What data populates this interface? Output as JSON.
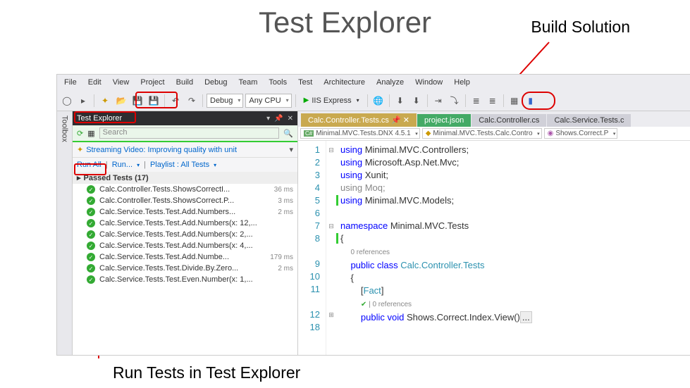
{
  "title": "Test Explorer",
  "annotations": {
    "build": "Build Solution",
    "run": "Run Tests in Test Explorer"
  },
  "menu": [
    "File",
    "Edit",
    "View",
    "Project",
    "Build",
    "Debug",
    "Team",
    "Tools",
    "Test",
    "Architecture",
    "Analyze",
    "Window",
    "Help"
  ],
  "toolbar": {
    "config": "Debug",
    "platform": "Any CPU",
    "start": "IIS Express"
  },
  "testExplorer": {
    "title": "Test Explorer",
    "searchPlaceholder": "Search",
    "streamingLink": "Streaming Video: Improving quality with unit",
    "actions": {
      "runAll": "Run All",
      "run": "Run...",
      "playlist": "Playlist : All Tests"
    },
    "groupLabel": "Passed Tests (17)",
    "tests": [
      {
        "name": "Calc.Controller.Tests.ShowsCorrectI...",
        "time": "36 ms"
      },
      {
        "name": "Calc.Controller.Tests.ShowsCorrect.P...",
        "time": "3 ms"
      },
      {
        "name": "Calc.Service.Tests.Test.Add.Numbers...",
        "time": "2 ms"
      },
      {
        "name": "Calc.Service.Tests.Test.Add.Numbers(x: 12,...",
        "time": ""
      },
      {
        "name": "Calc.Service.Tests.Test.Add.Numbers(x: 2,...",
        "time": ""
      },
      {
        "name": "Calc.Service.Tests.Test.Add.Numbers(x: 4,...",
        "time": ""
      },
      {
        "name": "Calc.Service.Tests.Test.Add.Numbe...",
        "time": "179 ms"
      },
      {
        "name": "Calc.Service.Tests.Test.Divide.By.Zero...",
        "time": "2 ms"
      },
      {
        "name": "Calc.Service.Tests.Test.Even.Number(x: 1,...",
        "time": ""
      }
    ]
  },
  "editor": {
    "tabs": [
      {
        "label": "Calc.Controller.Tests.cs",
        "active": true
      },
      {
        "label": "project.json",
        "active": false
      },
      {
        "label": "Calc.Controller.cs",
        "active": false
      },
      {
        "label": "Calc.Service.Tests.c",
        "active": false
      }
    ],
    "crumbs": [
      "Minimal.MVC.Tests.DNX 4.5.1",
      "Minimal.MVC.Tests.Calc.Contro",
      "Shows.Correct.P"
    ],
    "lines": [
      "1",
      "2",
      "3",
      "4",
      "5",
      "6",
      "7",
      "8",
      "",
      "9",
      "10",
      "11",
      "",
      "12",
      "18"
    ],
    "code": {
      "u1": "Minimal.MVC.Controllers;",
      "u2": "Microsoft.Asp.Net.Mvc;",
      "u3": "Xunit;",
      "u4": "Moq;",
      "u5": "Minimal.MVC.Models;",
      "ns": "Minimal.MVC.Tests",
      "ref0": "0 references",
      "cls": "Calc.Controller.Tests",
      "attr": "Fact",
      "ref1": "| 0 references",
      "method": "Shows.Correct.Index.View()"
    }
  }
}
